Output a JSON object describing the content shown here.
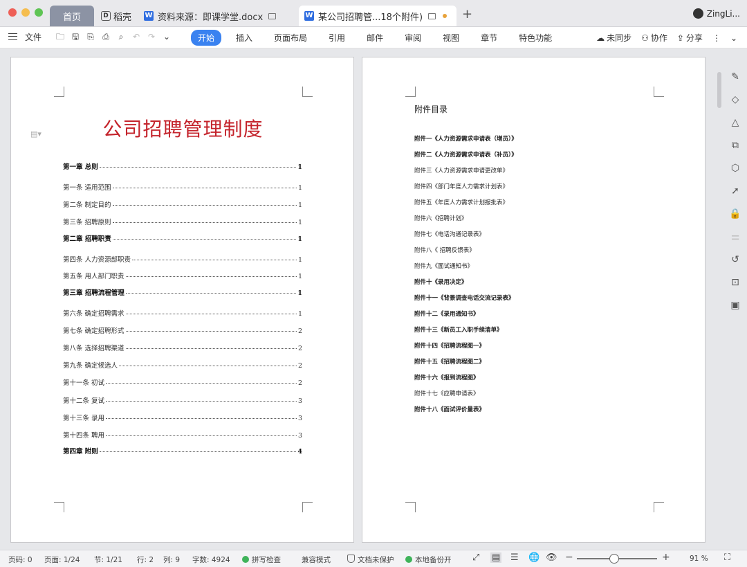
{
  "window": {
    "tabs": [
      {
        "label": "首页"
      },
      {
        "label": "稻壳"
      },
      {
        "label": "资料来源：即课学堂.docx"
      },
      {
        "label": "某公司招聘管...18个附件)"
      }
    ],
    "user_name": "ZingLi..."
  },
  "toolbar": {
    "file_label": "文件",
    "ribbon_tabs": [
      "开始",
      "插入",
      "页面布局",
      "引用",
      "邮件",
      "审阅",
      "视图",
      "章节",
      "特色功能"
    ],
    "active_tab": "开始",
    "sync_label": "未同步",
    "collab_label": "协作",
    "share_label": "分享"
  },
  "page_left": {
    "title": "公司招聘管理制度",
    "toc": [
      {
        "text": "第一章  总则",
        "page": "1",
        "bold": true
      },
      {
        "text": "第一条  适用范围",
        "page": "1",
        "bold": false
      },
      {
        "text": "第二条  制定目的",
        "page": "1",
        "bold": false
      },
      {
        "text": "第三条  招聘原则",
        "page": "1",
        "bold": false
      },
      {
        "text": "第二章  招聘职责",
        "page": "1",
        "bold": true
      },
      {
        "text": "第四条  人力资源部职责",
        "page": "1",
        "bold": false
      },
      {
        "text": "第五条 用人部门职责",
        "page": "1",
        "bold": false
      },
      {
        "text": "第三章  招聘流程管理",
        "page": "1",
        "bold": true
      },
      {
        "text": "第六条  确定招聘需求",
        "page": "1",
        "bold": false
      },
      {
        "text": "第七条  确定招聘形式",
        "page": "2",
        "bold": false
      },
      {
        "text": "第八条  选择招聘渠道",
        "page": "2",
        "bold": false
      },
      {
        "text": "第九条  确定候选人",
        "page": "2",
        "bold": false
      },
      {
        "text": "第十一条  初试",
        "page": "2",
        "bold": false
      },
      {
        "text": "第十二条  复试",
        "page": "3",
        "bold": false
      },
      {
        "text": "第十三条 录用",
        "page": "3",
        "bold": false
      },
      {
        "text": "第十四条  聘用",
        "page": "3",
        "bold": false
      },
      {
        "text": "第四章  附则",
        "page": "4",
        "bold": true
      }
    ]
  },
  "page_right": {
    "title": "附件目录",
    "items": [
      {
        "text": "附件一《人力资源需求申请表（增员）》",
        "bold": true
      },
      {
        "text": "附件二《人力资源需求申请表（补员）》",
        "bold": true
      },
      {
        "text": "附件三《人力资源需求申请更改单》",
        "bold": false
      },
      {
        "text": "附件四《部门年度人力需求计划表》",
        "bold": false
      },
      {
        "text": "附件五《年度人力需求计划报批表》",
        "bold": false
      },
      {
        "text": "附件六《招聘计划》",
        "bold": false
      },
      {
        "text": "附件七《电话沟通记录表》",
        "bold": false
      },
      {
        "text": "附件八《 招聘反馈表》",
        "bold": false
      },
      {
        "text": "附件九《面试通知书》",
        "bold": false
      },
      {
        "text": "附件十《录用决定》",
        "bold": true
      },
      {
        "text": "附件十一《背景调查电话交流记录表》",
        "bold": true
      },
      {
        "text": "附件十二《录用通知书》",
        "bold": true
      },
      {
        "text": "附件十三《新员工入职手续清单》",
        "bold": true
      },
      {
        "text": "附件十四《招聘流程图一》",
        "bold": true
      },
      {
        "text": "附件十五《招聘流程图二》",
        "bold": true
      },
      {
        "text": "附件十六《报到流程图》",
        "bold": true
      },
      {
        "text": "附件十七《应聘申请表》",
        "bold": false
      },
      {
        "text": "附件十八《面试评价量表》",
        "bold": true
      }
    ]
  },
  "statusbar": {
    "page_code": "页码: 0",
    "page": "页面: 1/24",
    "section": "节: 1/21",
    "row": "行: 2",
    "col": "列: 9",
    "words": "字数: 4924",
    "spell": "拼写检查",
    "compat": "兼容模式",
    "protect": "文档未保护",
    "backup": "本地备份开",
    "zoom": "91 %"
  }
}
